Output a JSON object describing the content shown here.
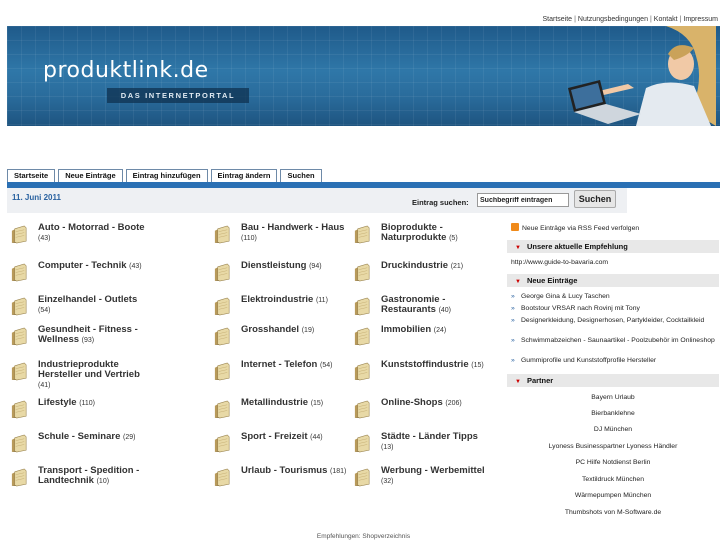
{
  "header": {
    "top_links": [
      "Startseite",
      "Nutzungsbedingungen",
      "Kontakt",
      "Impressum"
    ],
    "logo_text": "produktlink.de",
    "tagline": "DAS INTERNETPORTAL"
  },
  "tabs": [
    "Startseite",
    "Neue Einträge",
    "Eintrag hinzufügen",
    "Eintrag ändern",
    "Suchen"
  ],
  "date": "11. Juni 2011",
  "search": {
    "label": "Eintrag suchen:",
    "value": "Suchbegriff eintragen",
    "button": "Suchen"
  },
  "categories": [
    {
      "name": "Auto - Motorrad - Boote",
      "count": "(43)"
    },
    {
      "name": "Bau - Handwerk - Haus",
      "count": "(110)"
    },
    {
      "name": "Bioprodukte - Naturprodukte",
      "count": "(5)"
    },
    {
      "name": "Computer - Technik",
      "count": "(43)"
    },
    {
      "name": "Dienstleistung",
      "count": "(94)"
    },
    {
      "name": "Druckindustrie",
      "count": "(21)"
    },
    {
      "name": "Einzelhandel - Outlets",
      "count": "(54)"
    },
    {
      "name": "Elektroindustrie",
      "count": "(11)"
    },
    {
      "name": "Gastronomie - Restaurants",
      "count": "(40)"
    },
    {
      "name": "Gesundheit - Fitness - Wellness",
      "count": "(93)"
    },
    {
      "name": "Grosshandel",
      "count": "(19)"
    },
    {
      "name": "Immobilien",
      "count": "(24)"
    },
    {
      "name": "Industrieprodukte Hersteller und Vertrieb",
      "count": "(41)"
    },
    {
      "name": "Internet - Telefon",
      "count": "(54)"
    },
    {
      "name": "Kunststoffindustrie",
      "count": "(15)"
    },
    {
      "name": "Lifestyle",
      "count": "(110)"
    },
    {
      "name": "Metallindustrie",
      "count": "(15)"
    },
    {
      "name": "Online-Shops",
      "count": "(206)"
    },
    {
      "name": "Schule - Seminare",
      "count": "(29)"
    },
    {
      "name": "Sport - Freizeit",
      "count": "(44)"
    },
    {
      "name": "Städte - Länder Tipps",
      "count": "(13)"
    },
    {
      "name": "Transport - Spedition - Landtechnik",
      "count": "(10)"
    },
    {
      "name": "Urlaub - Tourismus",
      "count": "(181)"
    },
    {
      "name": "Werbung - Werbemittel",
      "count": "(32)"
    }
  ],
  "sidebar": {
    "rss": "Neue Einträge via RSS Feed verfolgen",
    "recommend_title": "Unsere aktuelle Empfehlung",
    "recommend_url": "http://www.guide-to-bavaria.com",
    "new_entries_title": "Neue Einträge",
    "new_entries": [
      "George Gina & Lucy Taschen",
      "Bootstour VRSAR nach Rovinj mit Tony",
      "Designerkleidung, Designerhosen, Partykleider, Cocktailkleid",
      "Schwimmabzeichen - Saunaartikel - Poolzubehör im Onlineshop",
      "Gummiprofile und Kunststoffprofile Hersteller"
    ],
    "partner_title": "Partner",
    "partners": [
      "Bayern Urlaub",
      "Bierbanklehne",
      "DJ München",
      "Lyoness Businesspartner Lyoness Händler",
      "PC Hilfe Notdienst Berlin",
      "Textildruck München",
      "Wärmepumpen München",
      "Thumbshots von M-Software.de"
    ]
  },
  "footer": "Empfehlungen: Shopverzeichnis",
  "colors": {
    "accent": "#2a70b4",
    "banner": "#2f77a8",
    "date": "#2a62a0",
    "rss": "#f08a1a"
  }
}
